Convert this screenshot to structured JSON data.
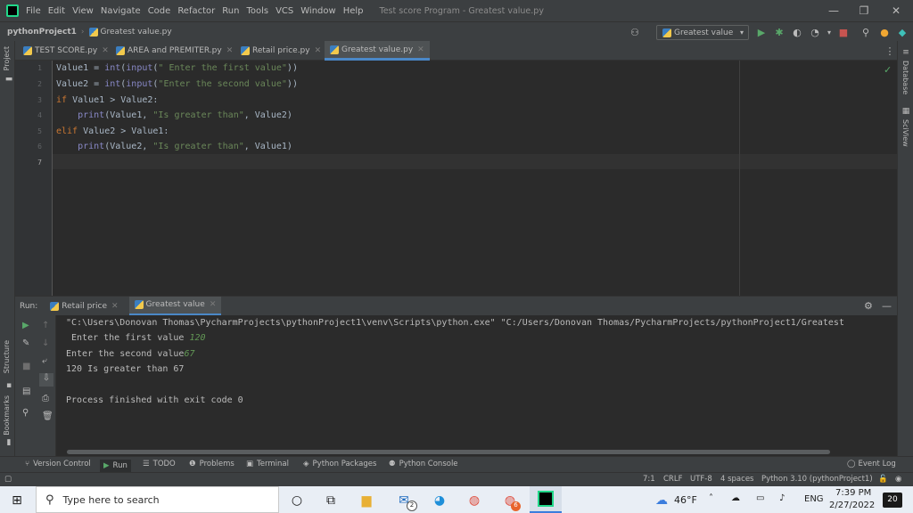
{
  "menubar": {
    "items": [
      "File",
      "Edit",
      "View",
      "Navigate",
      "Code",
      "Refactor",
      "Run",
      "Tools",
      "VCS",
      "Window",
      "Help"
    ],
    "window_title": "Test score Program - Greatest value.py"
  },
  "navbar": {
    "project": "pythonProject1",
    "file": "Greatest value.py",
    "run_config": "Greatest value"
  },
  "tabs": [
    {
      "label": "TEST SCORE.py"
    },
    {
      "label": "AREA and PREMITER.py"
    },
    {
      "label": "Retail price.py"
    },
    {
      "label": "Greatest value.py"
    }
  ],
  "side_tools": {
    "left_top": "Project",
    "left_structure": "Structure",
    "left_bookmarks": "Bookmarks",
    "right_database": "Database",
    "right_sciview": "SciView"
  },
  "editor": {
    "line_numbers": [
      "1",
      "2",
      "3",
      "4",
      "5",
      "6",
      "7"
    ]
  },
  "run_panel": {
    "label": "Run:",
    "tabs": [
      "Retail price",
      "Greatest value"
    ],
    "lines": {
      "l1": "\"C:\\Users\\Donovan Thomas\\PycharmProjects\\pythonProject1\\venv\\Scripts\\python.exe\" \"C:/Users/Donovan Thomas/PycharmProjects/pythonProject1/Greatest",
      "l2_prompt": " Enter the first value ",
      "l2_input": "120",
      "l3_prompt": "Enter the second value",
      "l3_input": "67",
      "l4": "120 Is greater than 67",
      "l5": "Process finished with exit code 0"
    }
  },
  "bottom_tools": [
    "Version Control",
    "Run",
    "TODO",
    "Problems",
    "Terminal",
    "Python Packages",
    "Python Console"
  ],
  "event_log": "Event Log",
  "status": {
    "position": "7:1",
    "line_sep": "CRLF",
    "encoding": "UTF-8",
    "indent": "4 spaces",
    "interpreter": "Python 3.10 (pythonProject1)"
  },
  "taskbar": {
    "search_placeholder": "Type here to search",
    "weather": "46°F",
    "lang": "ENG",
    "time": "7:39 PM",
    "date": "2/27/2022",
    "notif_count": "20",
    "mail_badge": "2",
    "chrome_badge": "6"
  }
}
